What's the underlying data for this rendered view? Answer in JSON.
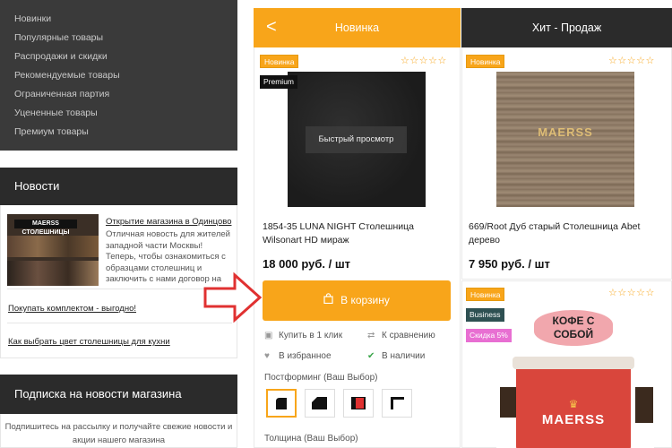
{
  "sidebar": {
    "categories": [
      "Новинки",
      "Популярные товары",
      "Распродажи и скидки",
      "Рекомендуемые товары",
      "Ограниченная партия",
      "Уцененные товары",
      "Премиум товары"
    ],
    "news_heading": "Новости",
    "news_image_sign": "MAERSS СТОЛЕШНИЦЫ",
    "news_title": "Открытие магазина в Одинцово",
    "news_text": "Отличная новость для жителей западной части Москвы! Теперь, чтобы ознакомиться с образцами столешниц и заключить с нами договор на",
    "news_links": [
      "Покупать комплектом - выгодно!",
      "Как выбрать цвет столешницы для кухни"
    ],
    "subscribe_heading": "Подписка на новости магазина",
    "subscribe_text": "Подпишитесь на рассылку и получайте свежие новости и акции нашего магазина"
  },
  "tabs": {
    "prev_arrow": "<",
    "new_label": "Новинка",
    "hit_label": "Хит - Продаж"
  },
  "product1": {
    "badge_new": "Новинка",
    "badge_premium": "Premium",
    "stars": "☆☆☆☆☆",
    "quick_view": "Быстрый просмотр",
    "name": "1854-35 LUNA NIGHT Столешница Wilsonart HD мираж",
    "price": "18 000 руб. / шт",
    "cart_label": "В корзину",
    "buy_one_click": "Купить в 1 клик",
    "compare": "К сравнению",
    "favorite": "В избранное",
    "in_stock": "В наличии",
    "postforming_label": "Постформинг (Ваш Выбор)",
    "thickness_label": "Толщина (Ваш Выбор)"
  },
  "product2": {
    "badge_new": "Новинка",
    "stars": "☆☆☆☆☆",
    "image_logo": "MAERSS",
    "name": "669/Root Дуб старый Столешница Abet дерево",
    "price": "7 950 руб. / шт"
  },
  "product3": {
    "badge_new": "Новинка",
    "badge_business": "Business",
    "badge_sale": "Скидка 5%",
    "stars": "☆☆☆☆☆",
    "sign_text": "КОФЕ С СОБОЙ",
    "logo_text": "MAERSS"
  },
  "colors": {
    "accent": "#f8a51a",
    "dark": "#2b2b2b",
    "arrow_red": "#e03131"
  }
}
